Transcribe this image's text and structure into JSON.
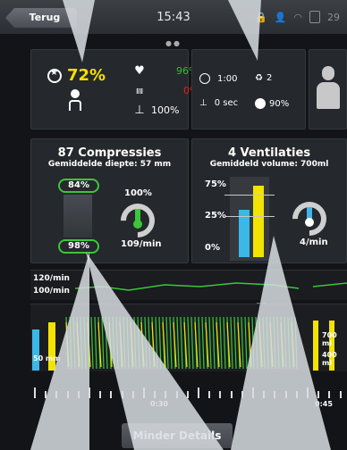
{
  "statusbar": {
    "back_label": "Terug",
    "time": "15:43",
    "battery_text": "29"
  },
  "score": {
    "value": "72%",
    "pulse_ok": "96%",
    "hands_off": "0%",
    "depth_rel": "100%"
  },
  "timing": {
    "time1": "1:00",
    "time2": "2",
    "sec": "0 sec",
    "flow": "90%"
  },
  "compressions": {
    "title": "87 Compressies",
    "subtitle": "Gemiddelde diepte: 57 mm",
    "top_pill": "84%",
    "bottom_pill": "98%",
    "recoil": "100%",
    "rate": "109/min"
  },
  "ventilations": {
    "title": "4 Ventilaties",
    "subtitle": "Gemiddeld volume: 700ml",
    "scale_75": "75%",
    "scale_25": "25%",
    "scale_0": "0%",
    "rate": "4/min",
    "bars": [
      {
        "color": "#3ab8e8",
        "fraction": 0.62
      },
      {
        "color": "#f2e300",
        "fraction": 0.93
      }
    ]
  },
  "rate_strip": {
    "label_120": "120/min",
    "label_100": "100/min",
    "marker": "31"
  },
  "waveform": {
    "label_50": "50 mm",
    "label_700": "700 ml",
    "label_400": "400 ml"
  },
  "timeline": {
    "t1": "0:30",
    "t2": "0:45"
  },
  "footer": {
    "less_details": "Minder Details"
  },
  "colors": {
    "accent_yellow": "#f5e000",
    "accent_green": "#3bc63b",
    "accent_red": "#e82020",
    "accent_blue": "#3ab8e8"
  }
}
